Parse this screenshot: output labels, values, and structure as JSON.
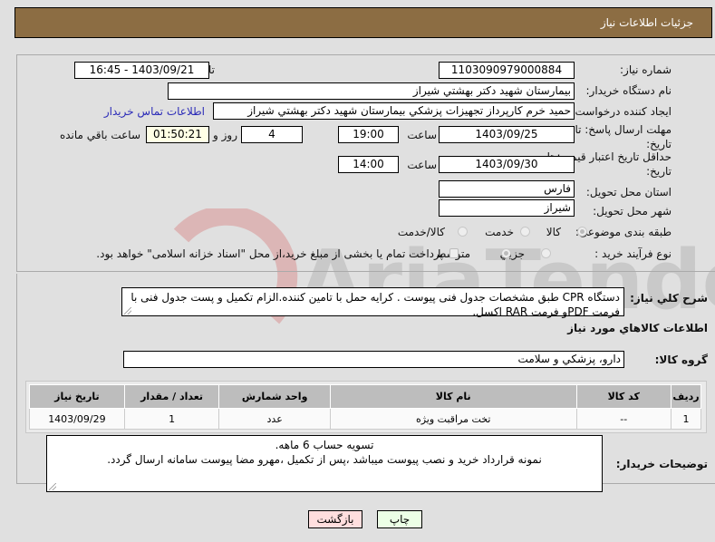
{
  "header": {
    "title": "جزئيات اطلاعات نياز"
  },
  "form": {
    "need_number": {
      "label": "شماره نياز:",
      "value": "1103090979000884"
    },
    "announce_datetime": {
      "label": "تاريخ و ساعت اعلان عمومي:",
      "value": "1403/09/21 - 16:45"
    },
    "buyer_org": {
      "label": "نام دستگاه خريدار:",
      "value": "بيمارستان شهيد دكتر بهشتي شيراز"
    },
    "requester": {
      "label": "ايجاد كننده درخواست:",
      "value": "حميد خرم كارپرداز تجهيزات پزشكي بيمارستان شهيد دكتر بهشتي شيراز",
      "contact_link": "اطلاعات تماس خريدار"
    },
    "deadline": {
      "label_line1": "مهلت ارسال پاسخ: تا",
      "label_line2": "تاريخ:",
      "date": "1403/09/25",
      "time_label": "ساعت",
      "time": "19:00",
      "days": "4",
      "days_label": "روز و",
      "remaining": "01:50:21",
      "remaining_label": "ساعت باقي مانده"
    },
    "price_validity": {
      "label_line1": "حداقل تاريخ اعتبار قيمت: تا",
      "label_line2": "تاريخ:",
      "date": "1403/09/30",
      "time_label": "ساعت",
      "time": "14:00"
    },
    "province": {
      "label": "استان محل تحويل:",
      "value": "فارس"
    },
    "city": {
      "label": "شهر محل تحويل:",
      "value": "شيراز"
    },
    "category": {
      "label": "طبقه بندی موضوعی:",
      "options": [
        "كالا",
        "خدمت",
        "كالا/خدمت"
      ],
      "selected": "كالا"
    },
    "process": {
      "label": "نوع فرآيند خريد :",
      "options": [
        "جزيي",
        "متوسط"
      ],
      "selected": "متوسط",
      "payment_check_label": "پرداخت تمام يا بخشی از مبلغ خريد،از محل \"اسناد خزانه اسلامی\" خواهد بود."
    }
  },
  "description": {
    "label": "شرح كلي نياز:",
    "value": "دستگاه CPR طبق مشخصات جدول فنی پیوست . کرایه حمل با تامین کننده.الزام تکمیل و پست جدول فنی با فرمت PDFو فرمت RAR اکسل."
  },
  "goods_section": {
    "title": "اطلاعات كالاهاي مورد نياز",
    "group_label": "گروه كالا:",
    "group_value": "دارو، پزشكي و سلامت"
  },
  "table": {
    "headers": [
      "رديف",
      "كد كالا",
      "نام كالا",
      "واحد شمارش",
      "تعداد / مقدار",
      "تاريخ نياز"
    ],
    "rows": [
      [
        "1",
        "--",
        "تخت مراقبت ويژه",
        "عدد",
        "1",
        "1403/09/29"
      ]
    ]
  },
  "buyer_notes": {
    "label": "توضيحات خريدار:",
    "line1": "تسویه حساب 6 ماهه.",
    "line2": "نمونه قرارداد خرید و نصب پیوست میباشد ،پس از تکمیل ،مهرو مضا پیوست سامانه ارسال گردد."
  },
  "buttons": {
    "print": "چاپ",
    "back": "بازگشت"
  },
  "watermark": {
    "text": "AriaTender.neT"
  }
}
